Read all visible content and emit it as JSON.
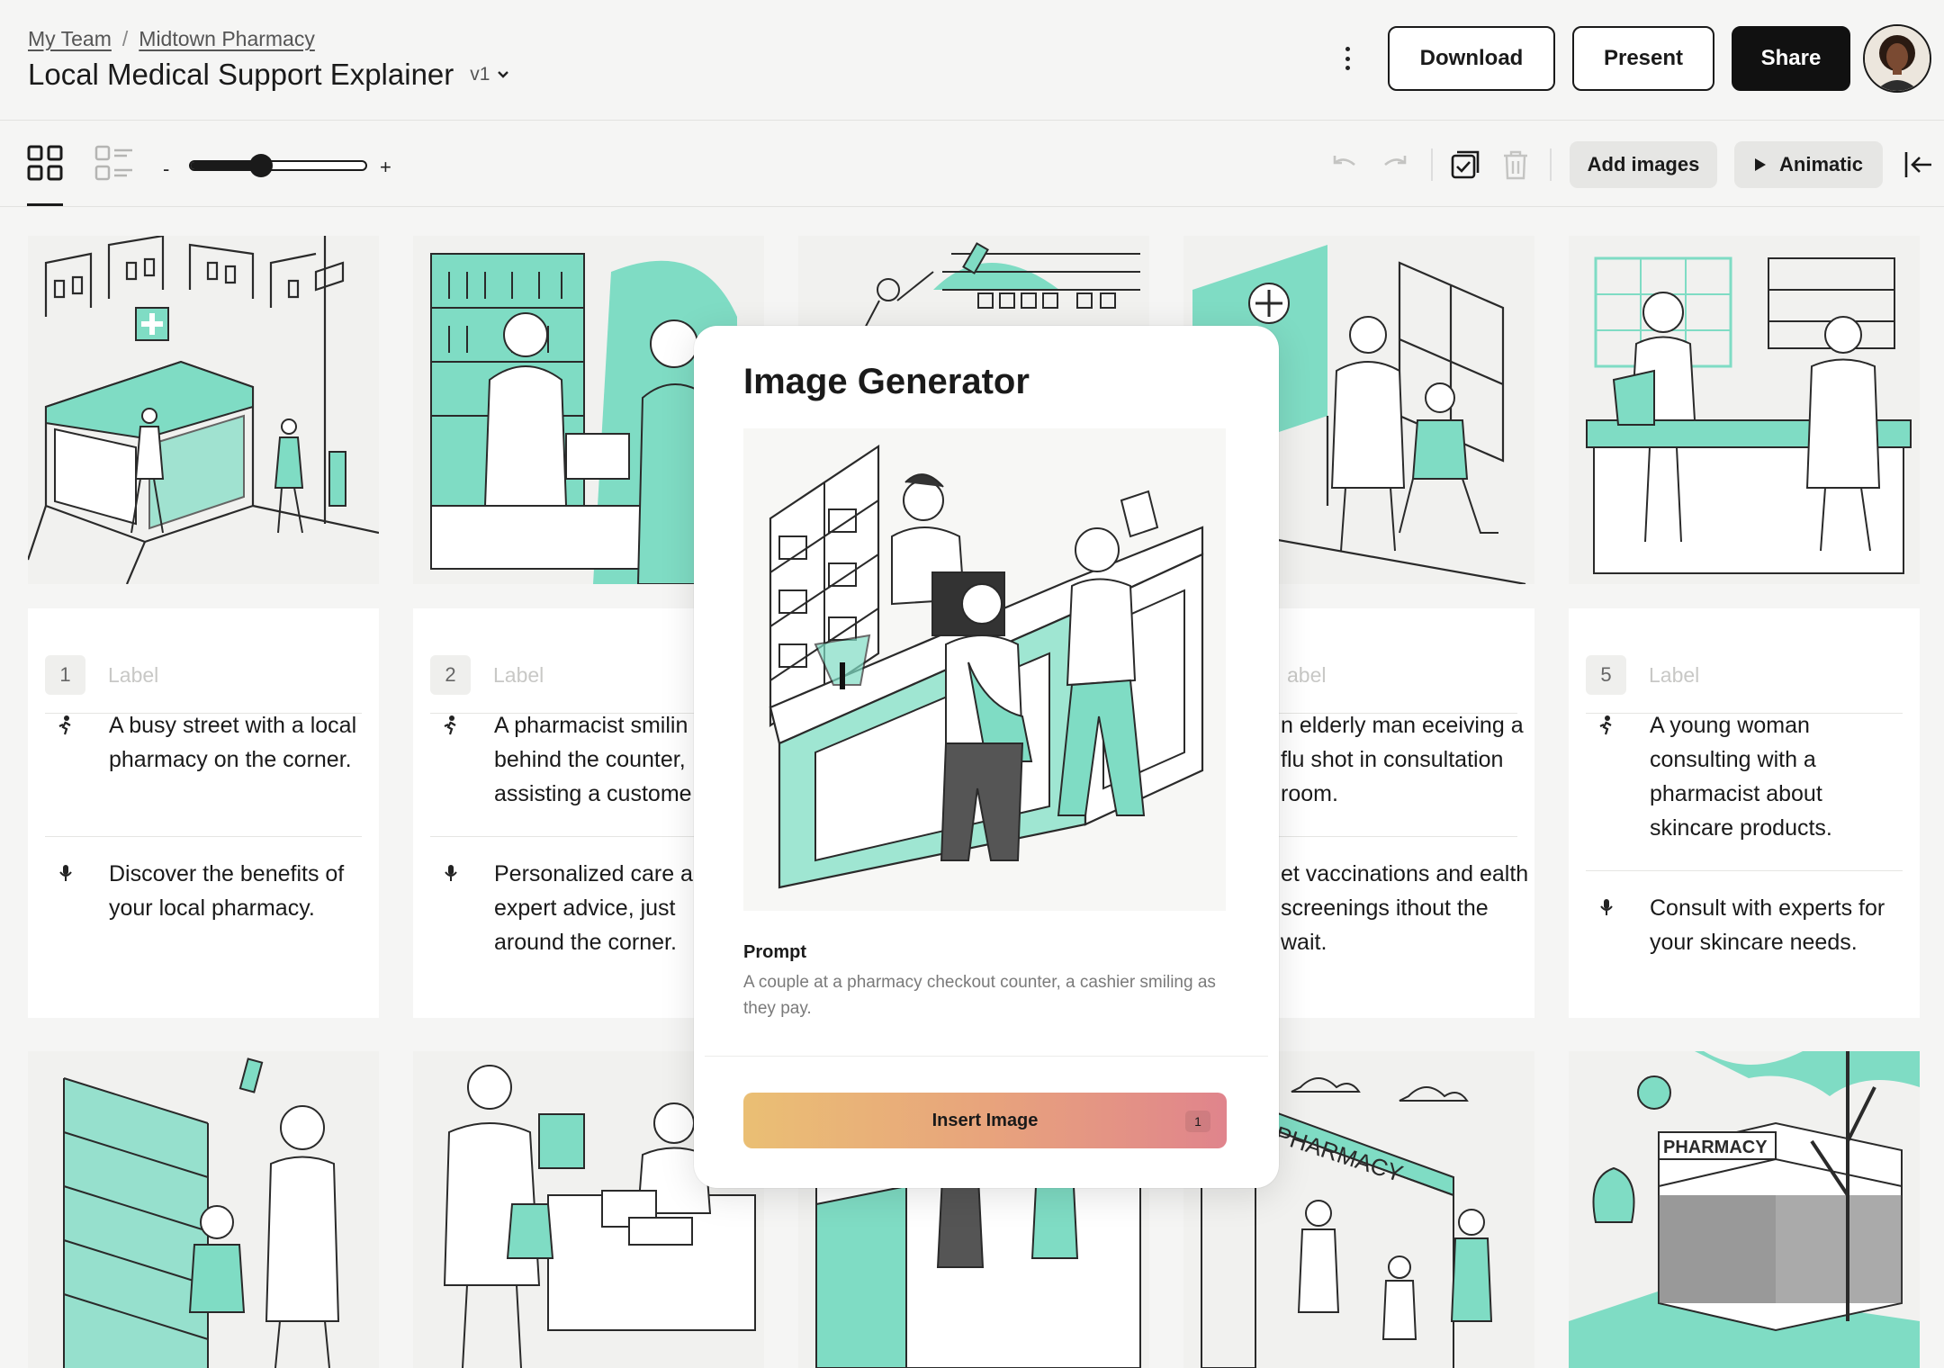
{
  "breadcrumb": {
    "team": "My Team",
    "project": "Midtown Pharmacy"
  },
  "document": {
    "title": "Local Medical Support Explainer",
    "version": "v1"
  },
  "header": {
    "download_label": "Download",
    "present_label": "Present",
    "share_label": "Share"
  },
  "toolbar": {
    "zoom_minus": "-",
    "zoom_plus": "+",
    "zoom_level": 0.4,
    "add_images_label": "Add images",
    "animatic_label": "Animatic"
  },
  "colors": {
    "accent": "#7fdcc4",
    "ink": "#1a1a1a",
    "card": "#ffffff",
    "page": "#f5f5f4"
  },
  "cards": [
    {
      "number": "1",
      "label_placeholder": "Label",
      "action": "A busy street with a local pharmacy on the corner.",
      "dialogue": "Discover the benefits of your local pharmacy."
    },
    {
      "number": "2",
      "label_placeholder": "Label",
      "action": "A pharmacist smilin behind the counter, assisting a custome",
      "dialogue": "Personalized care a expert advice, just around the corner."
    },
    {
      "number": "",
      "label_placeholder": "abel",
      "action": "n elderly man eceiving a flu shot in consultation room.",
      "dialogue": "et vaccinations and ealth screenings ithout the wait."
    },
    {
      "number": "5",
      "label_placeholder": "Label",
      "action": "A young woman consulting with a pharmacist about skincare products.",
      "dialogue": "Consult with experts for your skincare needs."
    }
  ],
  "dialog": {
    "title": "Image Generator",
    "prompt_label": "Prompt",
    "prompt_text": "A couple at a pharmacy checkout counter, a cashier smiling as they pay.",
    "insert_label": "Insert Image",
    "insert_count": "1"
  },
  "illustration_text": {
    "pharmacy_sign_1": "PHARMACY",
    "pharmacy_sign_2": "PHARMACY"
  }
}
